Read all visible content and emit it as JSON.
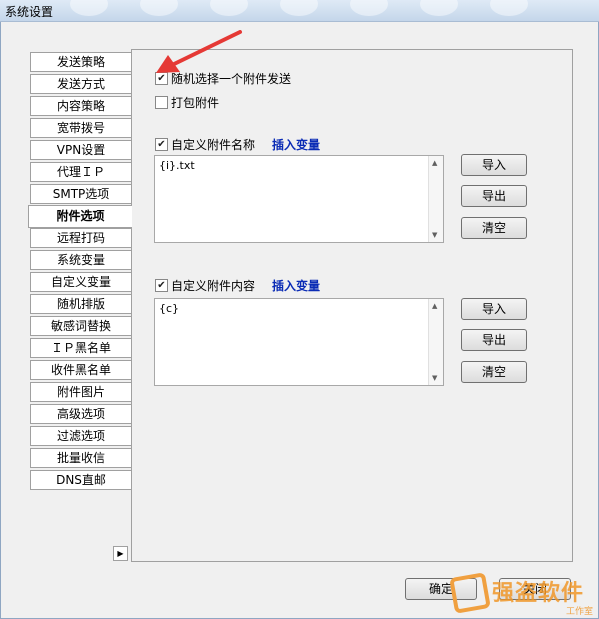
{
  "window": {
    "title": "系统设置"
  },
  "tabs": [
    {
      "label": "发送策略"
    },
    {
      "label": "发送方式"
    },
    {
      "label": "内容策略"
    },
    {
      "label": "宽带拨号"
    },
    {
      "label": "VPN设置"
    },
    {
      "label": "代理ＩＰ"
    },
    {
      "label": "SMTP选项"
    },
    {
      "label": "附件选项",
      "active": true
    },
    {
      "label": "远程打码"
    },
    {
      "label": "系统变量"
    },
    {
      "label": "自定义变量"
    },
    {
      "label": "随机排版"
    },
    {
      "label": "敏感词替换"
    },
    {
      "label": "ＩＰ黑名单"
    },
    {
      "label": "收件黑名单"
    },
    {
      "label": "附件图片"
    },
    {
      "label": "高级选项"
    },
    {
      "label": "过滤选项"
    },
    {
      "label": "批量收信"
    },
    {
      "label": "DNS直邮"
    }
  ],
  "panel": {
    "random_attachment": {
      "label": "随机选择一个附件发送",
      "checked": true
    },
    "pack_attachment": {
      "label": "打包附件",
      "checked": false
    },
    "custom_name": {
      "label": "自定义附件名称",
      "checked": true,
      "insert_link": "插入变量",
      "value": "{i}.txt"
    },
    "custom_content": {
      "label": "自定义附件内容",
      "checked": true,
      "insert_link": "插入变量",
      "value": "{c}"
    },
    "buttons": {
      "import": "导入",
      "export": "导出",
      "clear": "清空"
    }
  },
  "footer": {
    "ok": "确定",
    "close": "关闭"
  },
  "watermark": {
    "text": "强盗软件",
    "sub": "工作室"
  },
  "colors": {
    "link": "#0a2bb5",
    "arrow": "#e53935",
    "watermark": "#f0a040"
  }
}
